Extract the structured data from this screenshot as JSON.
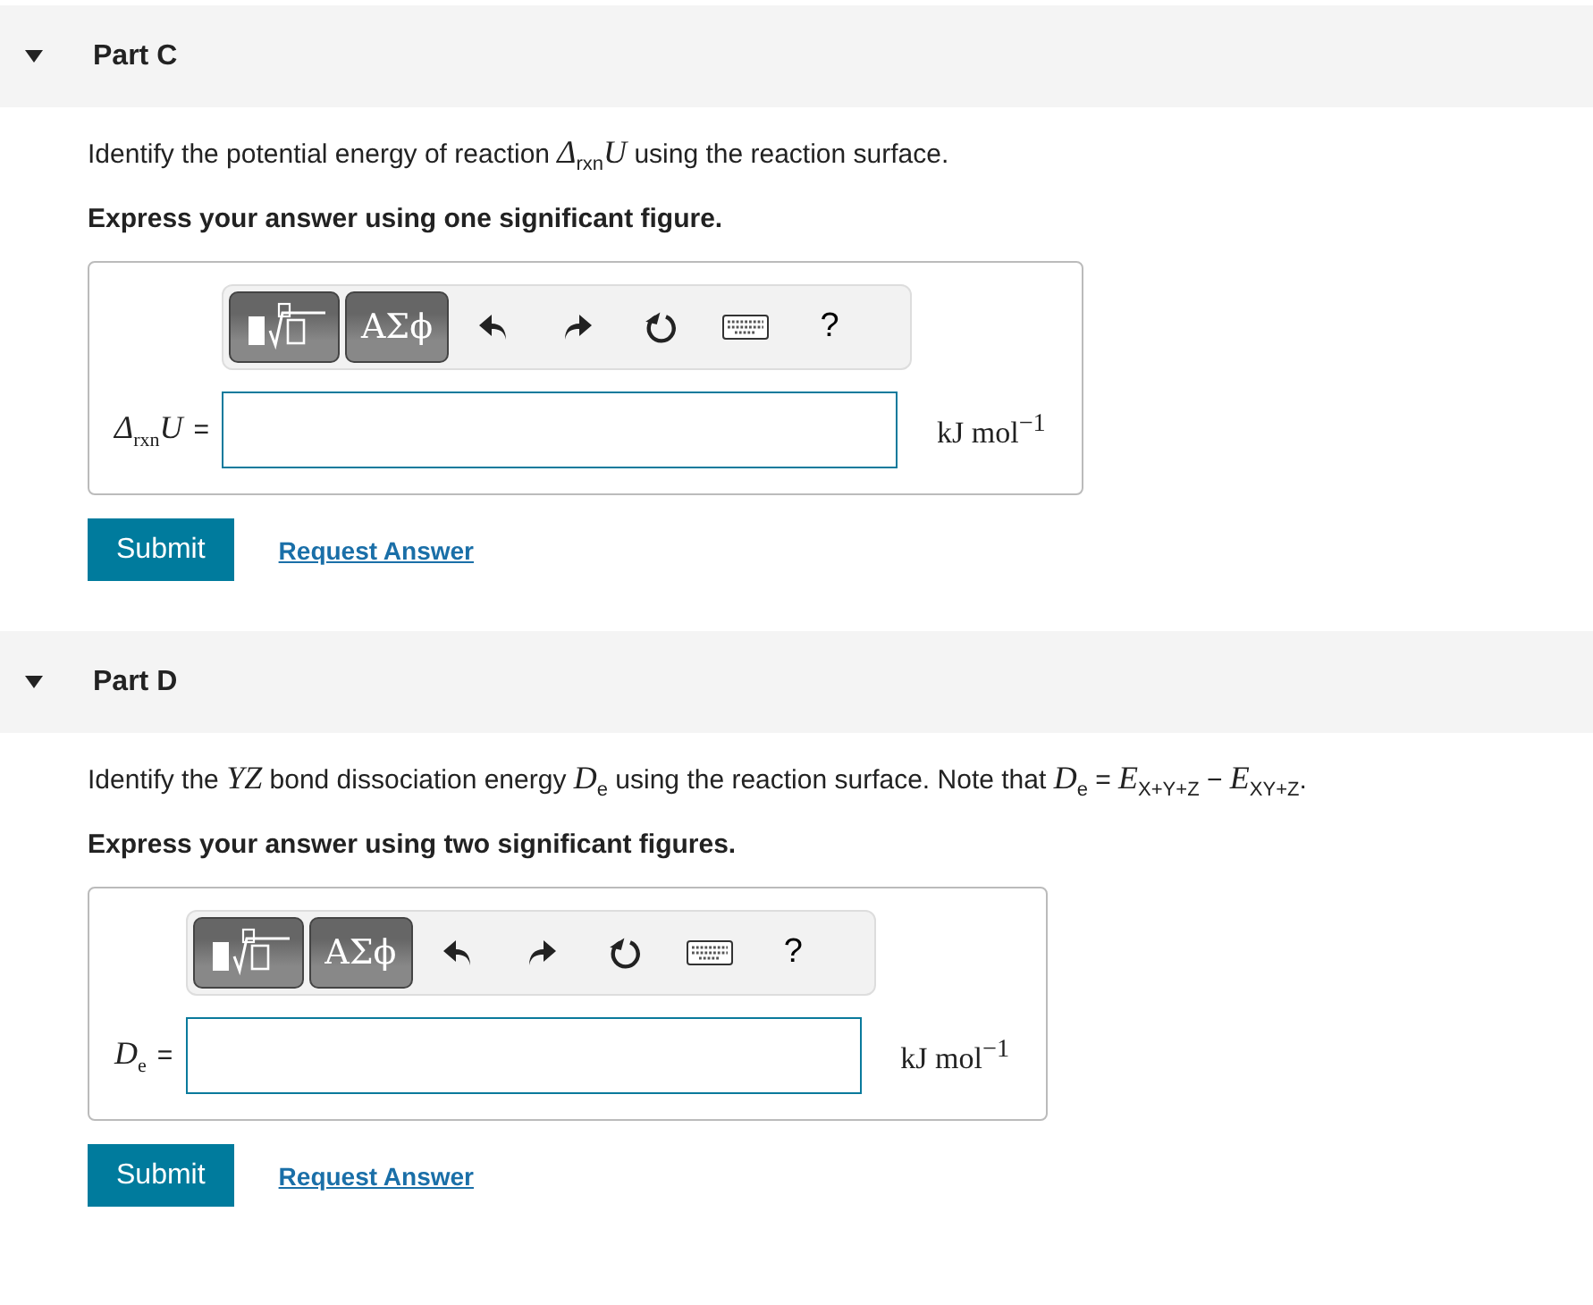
{
  "parts": [
    {
      "title": "Part C",
      "expanded": true,
      "question": "Identify the potential energy of reaction *Δ*$_{rxn}$*U* using the reaction surface.",
      "instruction": "Express your answer using one significant figure.",
      "toolbar": {
        "symbols": "ΑΣϕ",
        "help": "?"
      },
      "answer_label": "*Δ*$_{rxn}$*U*",
      "equals": "=",
      "unit": "kJ mol$^{−1}$",
      "submit": "Submit",
      "request": "Request Answer"
    },
    {
      "title": "Part D",
      "expanded": true,
      "question": "Identify the *YZ* bond dissociation energy *D*$_{e}$ using the reaction surface. Note that *D*$_{e}$ = *E*$_{X+Y+Z}$ − *E*$_{XY+Z}$.",
      "instruction": "Express your answer using two significant figures.",
      "toolbar": {
        "symbols": "ΑΣϕ",
        "help": "?"
      },
      "answer_label": "*D*$_{e}$",
      "equals": "=",
      "unit": "kJ mol$^{−1}$",
      "submit": "Submit",
      "request": "Request Answer"
    }
  ]
}
